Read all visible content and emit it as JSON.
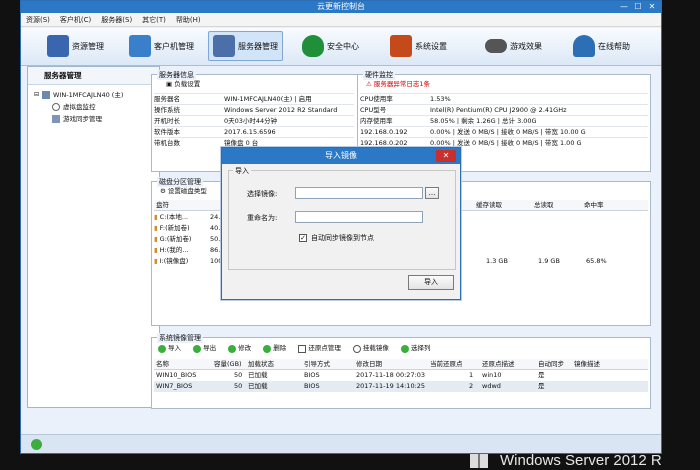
{
  "window": {
    "title": "云更新控制台",
    "min": "—",
    "max": "☐",
    "close": "✕"
  },
  "menu": [
    "资源(S)",
    "客户机(C)",
    "服务器(S)",
    "其它(T)",
    "帮助(H)"
  ],
  "toolbar": [
    {
      "label": "资源管理",
      "icon": "books-icon",
      "color": "#3a66b0"
    },
    {
      "label": "客户机管理",
      "icon": "monitor-icon",
      "color": "#3a7fc9"
    },
    {
      "label": "服务器管理",
      "icon": "server-icon",
      "color": "#4b6fa8"
    },
    {
      "label": "安全中心",
      "icon": "shield-icon",
      "color": "#1f8f3a"
    },
    {
      "label": "系统设置",
      "icon": "tools-icon",
      "color": "#c44a1b"
    },
    {
      "label": "游戏效果",
      "icon": "gamepad-icon",
      "color": "#555555"
    },
    {
      "label": "在线帮助",
      "icon": "person-icon",
      "color": "#2d6fb4"
    }
  ],
  "left": {
    "title": "服务器管理",
    "root": "WIN-1MFCAJLN40 (主)",
    "children": [
      "虚拟盘监控",
      "游戏同步管理"
    ]
  },
  "server_info": {
    "title": "服务器信息",
    "action": "负载设置",
    "rows": [
      [
        "服务器名",
        "WIN-1MFCAJLN40(主) | 启用"
      ],
      [
        "操作系统",
        "Windows Server 2012 R2 Standard"
      ],
      [
        "开机时长",
        "0天03小时44分钟"
      ],
      [
        "软件版本",
        "2017.6.15.6596"
      ],
      [
        "带机台数",
        "镜像盘 0 台"
      ]
    ]
  },
  "hardware": {
    "title": "硬件监控",
    "action": "服务器异常日志1条",
    "rows": [
      [
        "CPU使用率",
        "1.53%"
      ],
      [
        "CPU型号",
        "Intel(R) Pentium(R) CPU J2900 @ 2.41GHz"
      ],
      [
        "内存使用率",
        "58.05% | 剩余 1.26G | 总计 3.00G"
      ],
      [
        "192.168.0.192",
        "0.00% | 发送 0 MB/S | 接收 0 MB/S | 带宽 10.00 G"
      ],
      [
        "192.168.0.202",
        "0.00% | 发送 0 MB/S | 接收 0 MB/S | 带宽 1.00 G"
      ]
    ]
  },
  "disk": {
    "title": "磁盘分区管理",
    "action": "设置磁盘类型",
    "headers": [
      "盘符",
      "",
      "缓存读取",
      "总读取",
      "命中率"
    ],
    "rows": [
      {
        "name": "C:(本地...",
        "v": "24."
      },
      {
        "name": "F:(新加卷)",
        "v": "40."
      },
      {
        "name": "G:(新加卷)",
        "v": "50."
      },
      {
        "name": "H:(我的...",
        "v": "86."
      },
      {
        "name": "I:(镜像盘)",
        "v": "100.",
        "cache": "1.3 GB",
        "total": "1.9 GB",
        "hit": "65.8%"
      }
    ]
  },
  "images": {
    "title": "系统镜像管理",
    "buttons": [
      "导入",
      "导出",
      "修改",
      "删除",
      "还原点管理",
      "挂载镜像",
      "选择列"
    ],
    "headers": [
      "名称",
      "容量(GB)",
      "加载状态",
      "引导方式",
      "修改日期",
      "当前还原点",
      "还原点描述",
      "自动同步",
      "镜像描述"
    ],
    "rows": [
      [
        "WIN10_BIOS",
        "50",
        "已加载",
        "BIOS",
        "2017-11-18 00:27:03",
        "1",
        "win10",
        "是",
        ""
      ],
      [
        "WIN7_BIOS",
        "50",
        "已加载",
        "BIOS",
        "2017-11-19 14:10:25",
        "2",
        "wdwd",
        "是",
        ""
      ]
    ]
  },
  "dialog": {
    "title": "导入镜像",
    "close": "✕",
    "group": "导入",
    "select_label": "选择镜像:",
    "browse": "...",
    "rename_label": "重命名为:",
    "checkbox_label": "自动同步镜像到节点",
    "checkbox_checked": true,
    "ok": "导入"
  },
  "brand": "Windows Server 2012 R"
}
